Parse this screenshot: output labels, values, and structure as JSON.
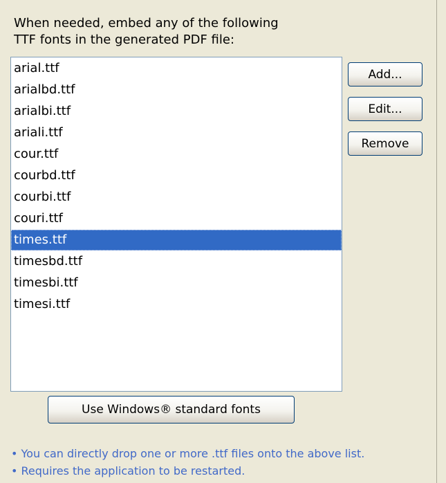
{
  "intro": {
    "line1": "When needed, embed any of the following",
    "line2": "TTF fonts in the generated PDF file:"
  },
  "fonts": {
    "selected": "times.ttf",
    "items": [
      "arial.ttf",
      "arialbd.ttf",
      "arialbi.ttf",
      "ariali.ttf",
      "cour.ttf",
      "courbd.ttf",
      "courbi.ttf",
      "couri.ttf",
      "times.ttf",
      "timesbd.ttf",
      "timesbi.ttf",
      "timesi.ttf"
    ]
  },
  "buttons": {
    "add": "Add...",
    "edit": "Edit...",
    "remove": "Remove",
    "standard_fonts": "Use Windows® standard fonts"
  },
  "notes": [
    "• You can directly drop one or more .ttf files onto the above list.",
    "• Requires the application to be restarted."
  ]
}
